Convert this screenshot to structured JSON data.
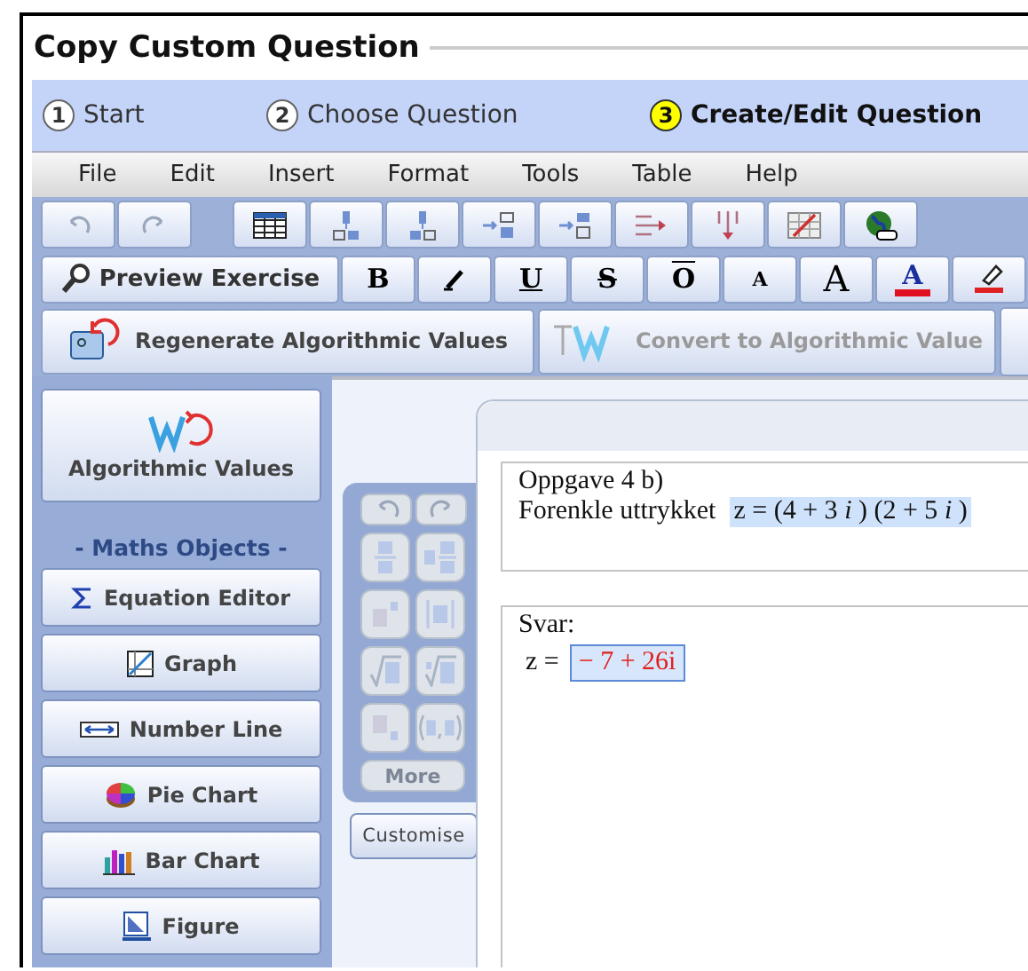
{
  "title": "Copy Custom Question",
  "steps": [
    {
      "number": "1",
      "label": "Start",
      "selected": false
    },
    {
      "number": "2",
      "label": "Choose Question",
      "selected": false
    },
    {
      "number": "3",
      "label": "Create/Edit Question",
      "selected": true
    }
  ],
  "menu": [
    "File",
    "Edit",
    "Insert",
    "Format",
    "Tools",
    "Table",
    "Help"
  ],
  "toolbar": [
    {
      "kind": "undo"
    },
    {
      "kind": "redo"
    },
    {
      "kind": "table"
    },
    {
      "kind": "row-above"
    },
    {
      "kind": "row-below"
    },
    {
      "kind": "col-left"
    },
    {
      "kind": "col-right"
    },
    {
      "kind": "merge"
    },
    {
      "kind": "split"
    },
    {
      "kind": "delete-table"
    },
    {
      "kind": "globe"
    }
  ],
  "format": [
    {
      "kind": "preview",
      "label": "Preview Exercise"
    },
    {
      "kind": "bold",
      "label": "B"
    },
    {
      "kind": "italic"
    },
    {
      "kind": "underline",
      "label": "U"
    },
    {
      "kind": "strike",
      "label": "S"
    },
    {
      "kind": "overline",
      "label": "O"
    },
    {
      "kind": "smaller",
      "label": "A"
    },
    {
      "kind": "larger",
      "label": "A"
    },
    {
      "kind": "color",
      "label": "A"
    },
    {
      "kind": "highlight"
    }
  ],
  "algorithmic": [
    {
      "kind": "regenerate",
      "label": "Regenerate Algorithmic Values",
      "disabled": false
    },
    {
      "kind": "convert",
      "label": "Convert to Algorithmic Value",
      "disabled": true
    }
  ],
  "sidebar": {
    "top": {
      "kind": "algorithmic",
      "label": "Algorithmic Values"
    },
    "heading": "- Maths Objects -",
    "buttons": [
      {
        "kind": "sigma",
        "label": "Equation Editor"
      },
      {
        "kind": "graph",
        "label": "Graph"
      },
      {
        "kind": "number-line",
        "label": "Number Line"
      },
      {
        "kind": "pie",
        "label": "Pie Chart"
      },
      {
        "kind": "bar",
        "label": "Bar Chart"
      },
      {
        "kind": "figure",
        "label": "Figure"
      }
    ]
  },
  "palette": {
    "buttons": [
      {
        "kind": "undo"
      },
      {
        "kind": "redo"
      },
      {
        "kind": "fraction"
      },
      {
        "kind": "mixed-fraction"
      },
      {
        "kind": "superscript"
      },
      {
        "kind": "abs"
      },
      {
        "kind": "sqrt"
      },
      {
        "kind": "nth-root"
      },
      {
        "kind": "subscript"
      },
      {
        "kind": "point"
      }
    ],
    "more": "More",
    "customise": "Customise"
  },
  "question": {
    "heading": "Oppgave 4 b)",
    "text": "Forenkle uttrykket",
    "math": "z = (4 + 3 *i* ) (2 + 5 *i* )"
  },
  "answer": {
    "label": "Svar:",
    "prefix": "z =",
    "value": "− 7 + 26i"
  }
}
